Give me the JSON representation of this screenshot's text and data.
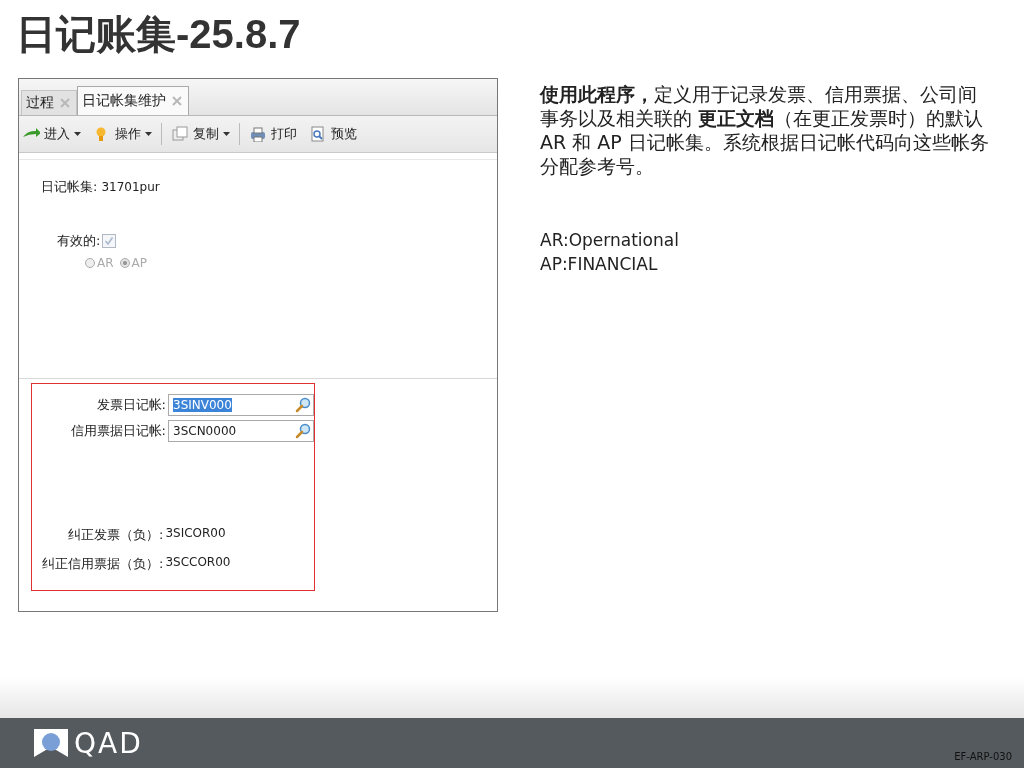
{
  "slide_title": "日记账集-25.8.7",
  "app": {
    "tabs": [
      {
        "label": "过程",
        "selected": false
      },
      {
        "label": "日记帐集维护",
        "selected": true
      }
    ],
    "toolbar": [
      {
        "label": "进入",
        "kind": "dropdown"
      },
      {
        "label": "操作",
        "kind": "dropdown"
      },
      {
        "label": "复制",
        "kind": "dropdown"
      },
      {
        "label": "打印",
        "kind": "button"
      },
      {
        "label": "预览",
        "kind": "button"
      }
    ],
    "journal_set": {
      "label": "日记帐集:",
      "value": "31701pur"
    },
    "active": {
      "label": "有效的:",
      "checked": true,
      "disabled": true
    },
    "types": [
      {
        "label": "AR",
        "selected": false
      },
      {
        "label": "AP",
        "selected": true
      }
    ],
    "lookups": [
      {
        "label": "发票日记帐:",
        "value": "3SINV000",
        "highlighted": true
      },
      {
        "label": "信用票据日记帐:",
        "value": "3SCN0000",
        "highlighted": false
      }
    ],
    "corrections": [
      {
        "label": "纠正发票（负）:",
        "value": "3SICOR00"
      },
      {
        "label": "纠正信用票据（负）:",
        "value": "3SCCOR00"
      }
    ]
  },
  "description": "**使用此程序，**定义用于记录发票、信用票据、公司间事务以及相关联的 **更正文档**（在更正发票时）的默认 AR 和 AP 日记帐集。系统根据日记帐代码向这些帐务分配参考号。",
  "notes": [
    "AR:Opernational",
    "AP:FINANCIAL"
  ],
  "footer": {
    "logo": "QAD",
    "code": "EF-ARP-030"
  }
}
